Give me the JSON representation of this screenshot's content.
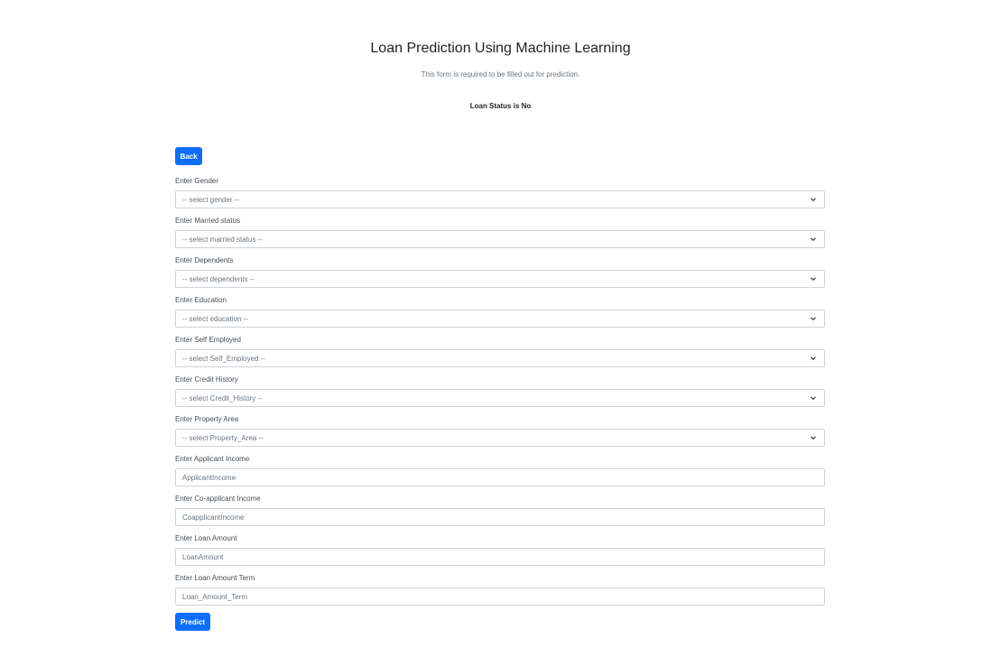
{
  "header": {
    "title": "Loan Prediction Using Machine Learning",
    "subtitle": "This form is required to be filled out for prediction.",
    "status": "Loan Status is No"
  },
  "buttons": {
    "back_label": "Back",
    "predict_label": "Predict",
    "accent_color": "#0d6efd"
  },
  "fields": [
    {
      "label": "Enter Gender",
      "type": "select",
      "value": "-- select gender --"
    },
    {
      "label": "Enter Married status",
      "type": "select",
      "value": "-- select married status --"
    },
    {
      "label": "Enter Dependents",
      "type": "select",
      "value": "-- select dependents --"
    },
    {
      "label": "Enter Education",
      "type": "select",
      "value": "-- select education --"
    },
    {
      "label": "Enter Self Employed",
      "type": "select",
      "value": "-- select Self_Employed --"
    },
    {
      "label": "Enter Credit History",
      "type": "select",
      "value": "-- select Credit_History --"
    },
    {
      "label": "Enter Property Area",
      "type": "select",
      "value": "-- select Property_Area --"
    },
    {
      "label": "Enter Applicant Income",
      "type": "input",
      "placeholder": "ApplicantIncome"
    },
    {
      "label": "Enter Co-applicant Income",
      "type": "input",
      "placeholder": "CoapplicantIncome"
    },
    {
      "label": "Enter Loan Amount",
      "type": "input",
      "placeholder": "LoanAmount"
    },
    {
      "label": "Enter Loan Amount Term",
      "type": "input",
      "placeholder": "Loan_Amount_Term"
    }
  ]
}
